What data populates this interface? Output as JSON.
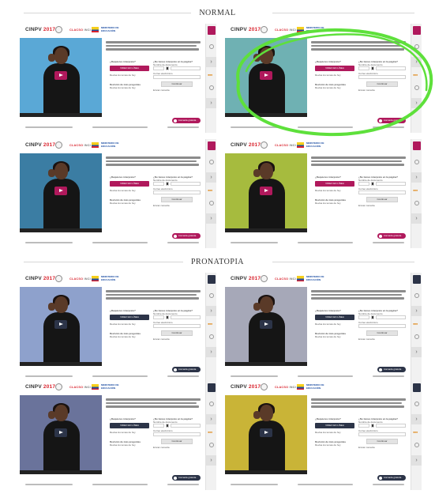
{
  "sections": [
    {
      "title": "NORMAL"
    },
    {
      "title": "PRONATOPIA"
    }
  ],
  "mockup": {
    "logo_prefix": "CINPV",
    "logo_year": "2017",
    "brand_red": "CLACSO",
    "brand_grey": "INCI",
    "gov_text": "MINISTERIO DE EDUCACIÓN",
    "question_left": "¿Requieres interprete?",
    "cta_label": "VIDEO EN LÍNEA",
    "left_link": "Revisa los temas de hoy",
    "left_note_title": "Revisión de más preguntas",
    "left_note_text": "Revisa los temas de hoy",
    "right_title": "¿No tienes interprete en la página?",
    "right_label_1": "Nombre de documento",
    "right_label_2": "Correo electrónico",
    "submit_label": "Continuar",
    "right_foot": "Enviar consulta",
    "pill_label": "Llamada gratuita"
  },
  "palette": {
    "normal_accent": "#b0195c",
    "pronatopia_accent": "#2c3448",
    "highlight": "#5ee03b"
  },
  "variants": [
    {
      "group": "NORMAL",
      "video_bg": "#5aa8d6",
      "accent": "#b0195c",
      "badge": "#b0195c"
    },
    {
      "group": "NORMAL",
      "video_bg": "#6fb1b3",
      "accent": "#b0195c",
      "badge": "#b0195c"
    },
    {
      "group": "NORMAL",
      "video_bg": "#3b7da3",
      "accent": "#b0195c",
      "badge": "#b0195c"
    },
    {
      "group": "NORMAL",
      "video_bg": "#a6bb3e",
      "accent": "#b0195c",
      "badge": "#b0195c"
    },
    {
      "group": "PRONATOPIA",
      "video_bg": "#8ea1cc",
      "accent": "#2c3448",
      "badge": "#2c3448"
    },
    {
      "group": "PRONATOPIA",
      "video_bg": "#a6a8b8",
      "accent": "#2c3448",
      "badge": "#2c3448"
    },
    {
      "group": "PRONATOPIA",
      "video_bg": "#6a739b",
      "accent": "#2c3448",
      "badge": "#2c3448"
    },
    {
      "group": "PRONATOPIA",
      "video_bg": "#c9b437",
      "accent": "#2c3448",
      "badge": "#2c3448"
    }
  ],
  "icons": {
    "seal": "seal-icon",
    "flag": "flag-icon",
    "play": "play-icon",
    "side_arrow": "chevron-right-icon",
    "side_user": "user-icon",
    "pill": "phone-icon"
  }
}
